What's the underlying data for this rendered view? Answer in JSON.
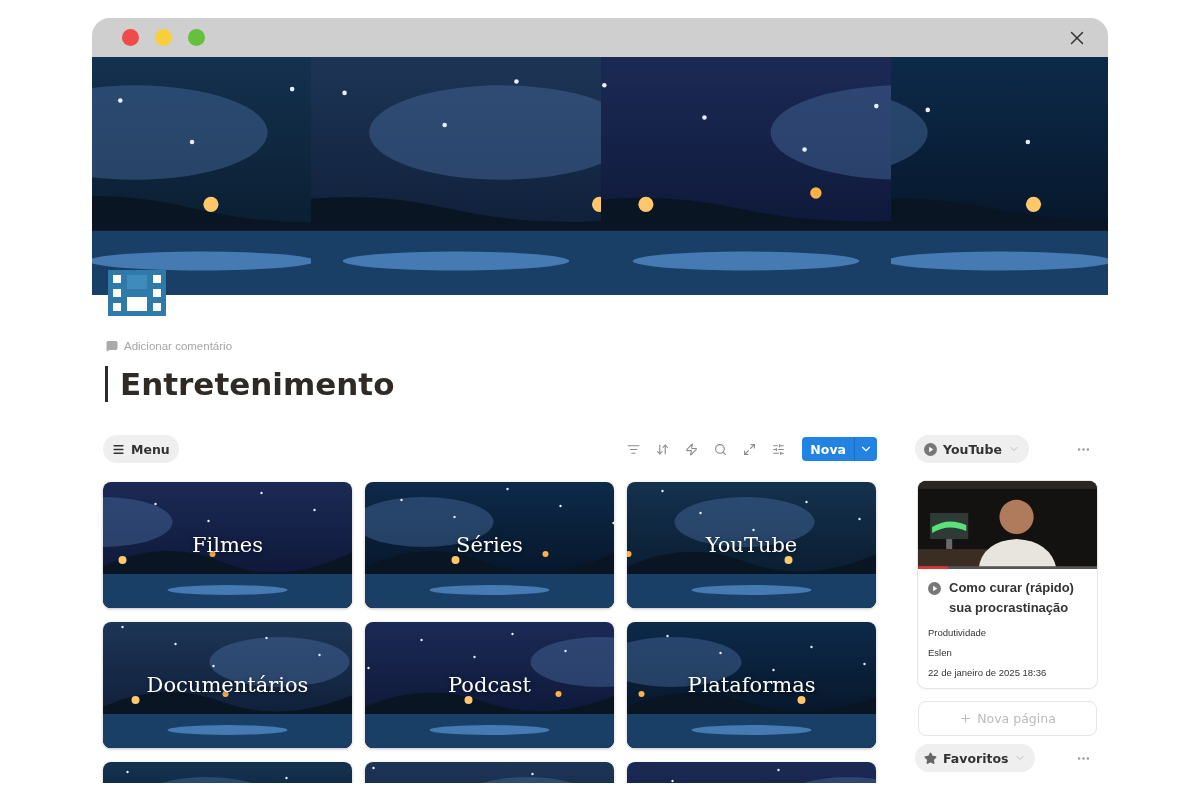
{
  "window": {
    "controls": [
      {
        "color": "#ee4b4b"
      },
      {
        "color": "#f7cf3c"
      },
      {
        "color": "#65c03f"
      }
    ]
  },
  "banner": {
    "pictures": [
      {
        "kind": "picture"
      },
      {
        "kind": "picture"
      },
      {
        "kind": "picture"
      },
      {
        "kind": "picture"
      }
    ]
  },
  "page": {
    "comment": "Adicionar comentário",
    "title": "Entretenimento"
  },
  "toolbar": {
    "menu": "Menu",
    "new_button": "Nova"
  },
  "cards": [
    {
      "label": "Filmes"
    },
    {
      "label": "Séries"
    },
    {
      "label": "YouTube"
    },
    {
      "label": "Documentários"
    },
    {
      "label": "Podcast"
    },
    {
      "label": "Plataformas"
    },
    {
      "kind": "picture"
    },
    {
      "kind": "picture"
    },
    {
      "kind": "picture"
    }
  ],
  "sidebar": {
    "view": "YouTube",
    "video": {
      "title": "Como curar (rápido) sua procrastinação",
      "fields": [
        "Produtividade",
        "Eslen",
        "22 de janeiro de 2025 18:36"
      ]
    },
    "new_page": "Nova página",
    "favorites": "Favoritos"
  }
}
